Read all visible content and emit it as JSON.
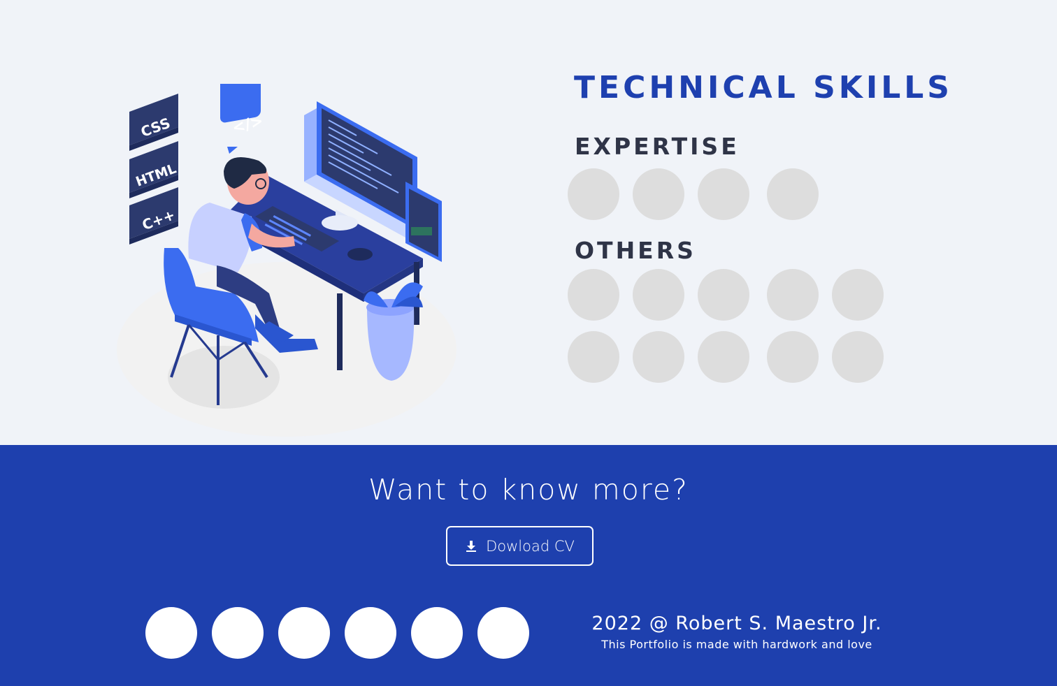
{
  "skills": {
    "title": "TECHNICAL SKILLS",
    "expertise_title": "EXPERTISE",
    "others_title": "OTHERS",
    "expertise_icons": 4,
    "others_icons": 10
  },
  "illustration": {
    "badges": [
      "CSS",
      "HTML",
      "C++"
    ],
    "code_bubble": "</>"
  },
  "footer": {
    "cta": "Want to know more?",
    "download_label": "Dowload CV",
    "download_icon": "download-icon",
    "social_links_count": 6,
    "copyright": "2022 @ Robert S. Maestro Jr.",
    "tagline": "This Portfolio is made with hardwork and love"
  },
  "colors": {
    "background": "#f0f3f8",
    "accent": "#1e40ae",
    "heading": "#2f3447",
    "placeholder": "#dddddd"
  }
}
